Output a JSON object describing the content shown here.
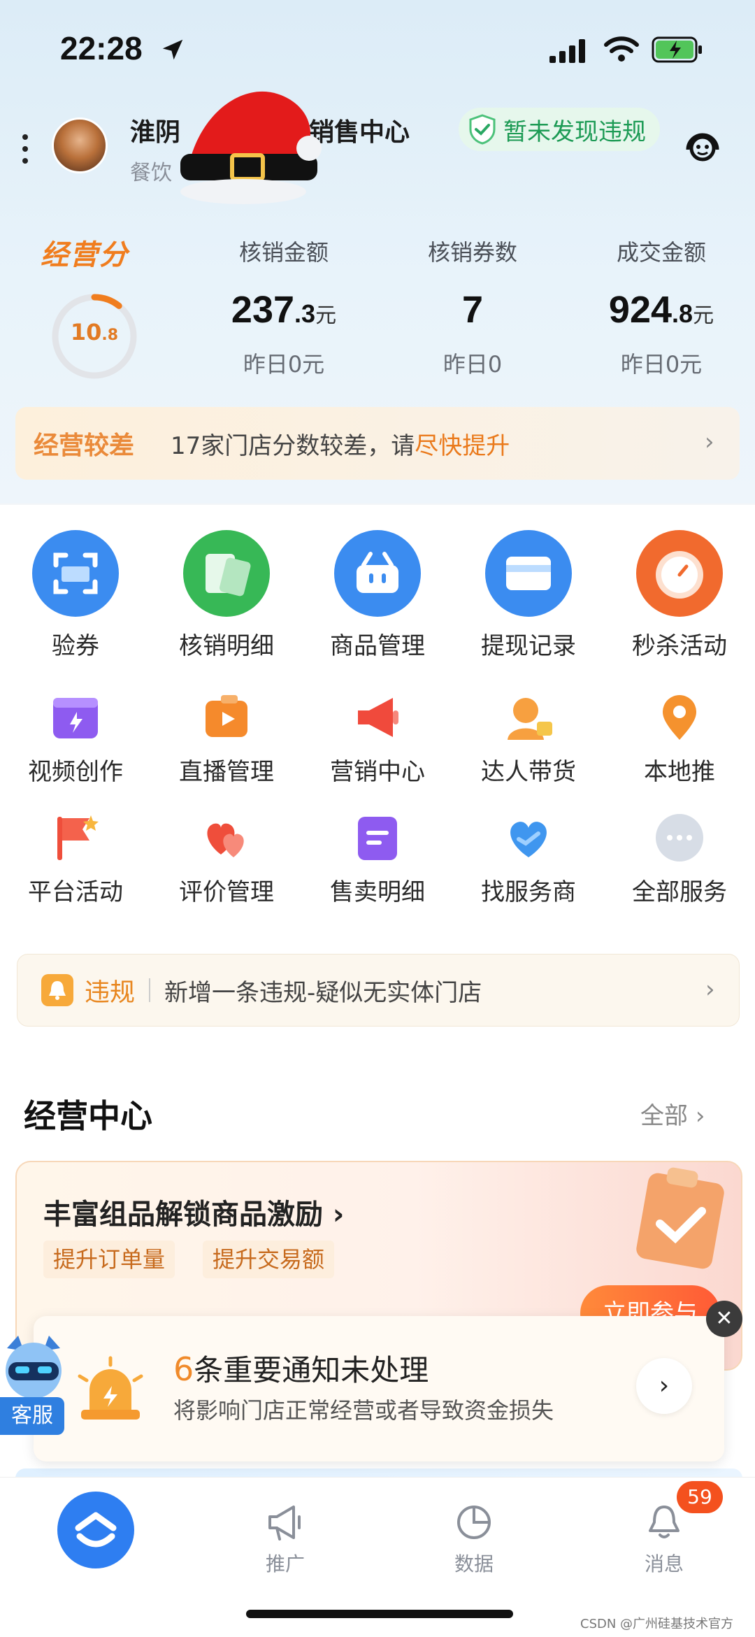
{
  "status_bar": {
    "time": "22:28"
  },
  "header": {
    "store_name_left": "淮阴",
    "store_name_right": "食品销售中心",
    "store_category": "餐饮",
    "compliance_badge": "暂未发现违规"
  },
  "score": {
    "title": "经营分",
    "value_int": "10",
    "value_dec": ".8",
    "progress_fraction": 0.108
  },
  "metrics": [
    {
      "label": "核销金额",
      "value_int": "237",
      "value_dec": ".3",
      "unit": "元",
      "yesterday": "昨日0元"
    },
    {
      "label": "核销券数",
      "value_int": "7",
      "value_dec": "",
      "unit": "",
      "yesterday": "昨日0"
    },
    {
      "label": "成交金额",
      "value_int": "924",
      "value_dec": ".8",
      "unit": "元",
      "yesterday": "昨日0元"
    }
  ],
  "perf_bar": {
    "tag": "经营较差",
    "message": "17家门店分数较差，请",
    "highlight": "尽快提升"
  },
  "services": [
    {
      "label": "验券",
      "icon": "scan-icon"
    },
    {
      "label": "核销明细",
      "icon": "cards-icon"
    },
    {
      "label": "商品管理",
      "icon": "basket-icon"
    },
    {
      "label": "提现记录",
      "icon": "wallet-icon"
    },
    {
      "label": "秒杀活动",
      "icon": "clock-icon"
    },
    {
      "label": "视频创作",
      "icon": "video-icon"
    },
    {
      "label": "直播管理",
      "icon": "live-icon"
    },
    {
      "label": "营销中心",
      "icon": "megaphone-icon"
    },
    {
      "label": "达人带货",
      "icon": "influencer-icon"
    },
    {
      "label": "本地推",
      "icon": "location-icon"
    },
    {
      "label": "平台活动",
      "icon": "flag-icon"
    },
    {
      "label": "评价管理",
      "icon": "hearts-icon"
    },
    {
      "label": "售卖明细",
      "icon": "list-icon"
    },
    {
      "label": "找服务商",
      "icon": "heart-handshake-icon"
    },
    {
      "label": "全部服务",
      "icon": "more-icon"
    }
  ],
  "violation": {
    "tag": "违规",
    "message": "新增一条违规-疑似无实体门店"
  },
  "business_center": {
    "title": "经营中心",
    "more": "全部"
  },
  "promo": {
    "title": "丰富组品解锁商品激励",
    "tags": [
      "提升订单量",
      "提升交易额"
    ],
    "button": "立即参与"
  },
  "notice": {
    "count": "6",
    "title_rest": "条重要通知未处理",
    "subtitle": "将影响门店正常经营或者导致资金损失"
  },
  "customer_service": {
    "label": "客服"
  },
  "tabs": [
    {
      "label": "推广",
      "icon": "megaphone-icon"
    },
    {
      "label": "数据",
      "icon": "pie-chart-icon"
    },
    {
      "label": "消息",
      "icon": "bell-icon"
    }
  ],
  "message_badge": "59",
  "watermark": "CSDN @广州硅基技术官方",
  "colors": {
    "accent_orange": "#f07d1e",
    "brand_blue": "#2e7ef1",
    "success_green": "#1d9b55",
    "badge_red": "#f4511e"
  }
}
